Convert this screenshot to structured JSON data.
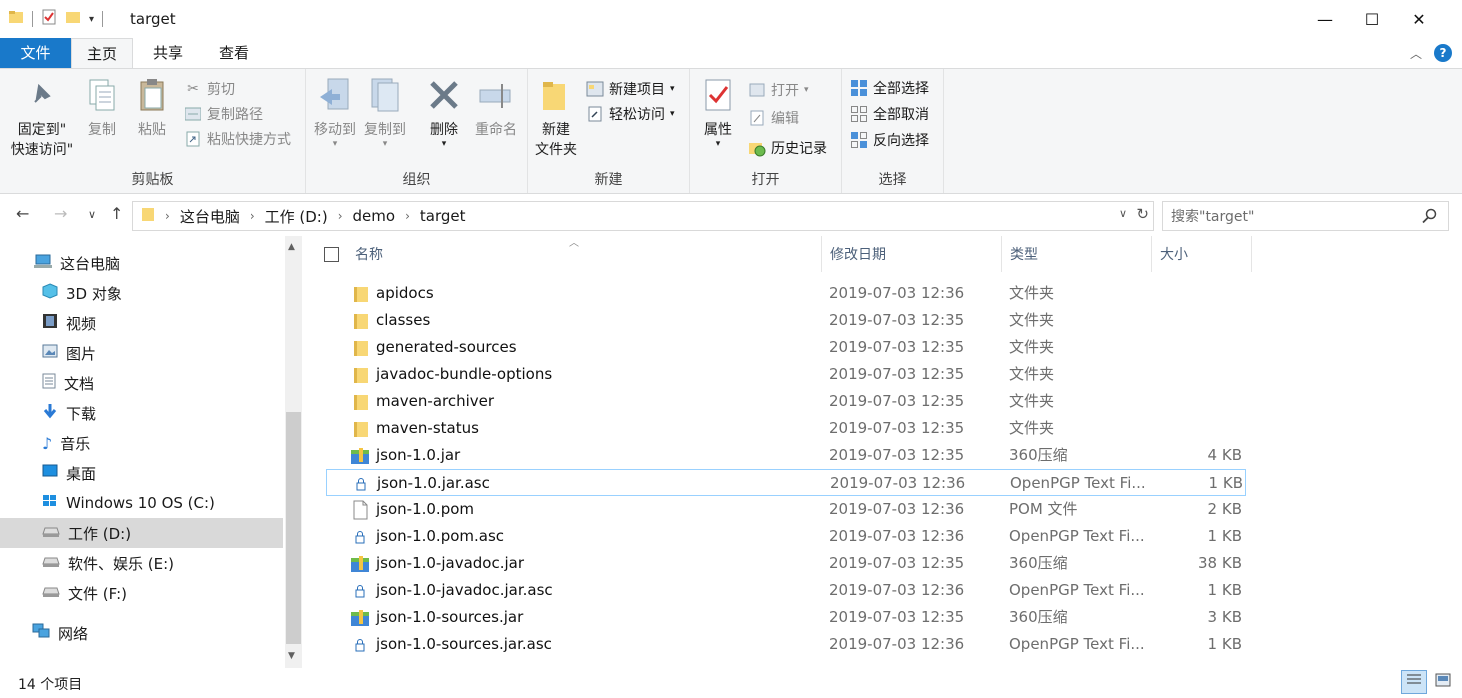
{
  "window": {
    "title": "target",
    "minimize": "—",
    "maximize": "☐",
    "close": "✕"
  },
  "ribbon_tabs": [
    "文件",
    "主页",
    "共享",
    "查看"
  ],
  "ribbon": {
    "clipboard": {
      "label": "剪贴板",
      "pin": "固定到\"\n快速访问\"",
      "pin_line1": "固定到\"",
      "pin_line2": "快速访问\"",
      "copy": "复制",
      "paste": "粘贴",
      "cut": "剪切",
      "copy_path": "复制路径",
      "paste_shortcut": "粘贴快捷方式"
    },
    "organize": {
      "label": "组织",
      "move_to": "移动到",
      "copy_to": "复制到",
      "delete": "删除",
      "rename": "重命名"
    },
    "new": {
      "label": "新建",
      "new_folder_line1": "新建",
      "new_folder_line2": "文件夹",
      "new_item": "新建项目",
      "easy_access": "轻松访问"
    },
    "open": {
      "label": "打开",
      "properties": "属性",
      "open": "打开",
      "edit": "编辑",
      "history": "历史记录"
    },
    "select": {
      "label": "选择",
      "select_all": "全部选择",
      "select_none": "全部取消",
      "invert": "反向选择"
    }
  },
  "address": {
    "crumbs": [
      "这台电脑",
      "工作 (D:)",
      "demo",
      "target"
    ],
    "search_placeholder": "搜索\"target\""
  },
  "nav_pane": [
    {
      "label": "这台电脑",
      "icon": "computer-icon",
      "indent": 1
    },
    {
      "label": "3D 对象",
      "icon": "cube-icon",
      "indent": 2
    },
    {
      "label": "视频",
      "icon": "video-icon",
      "indent": 2
    },
    {
      "label": "图片",
      "icon": "pictures-icon",
      "indent": 2
    },
    {
      "label": "文档",
      "icon": "document-icon",
      "indent": 2
    },
    {
      "label": "下载",
      "icon": "download-icon",
      "indent": 2
    },
    {
      "label": "音乐",
      "icon": "music-icon",
      "indent": 2
    },
    {
      "label": "桌面",
      "icon": "desktop-icon",
      "indent": 2
    },
    {
      "label": "Windows 10 OS (C:)",
      "icon": "windows-drive-icon",
      "indent": 2
    },
    {
      "label": "工作 (D:)",
      "icon": "drive-icon",
      "indent": 2,
      "selected": true
    },
    {
      "label": "软件、娱乐 (E:)",
      "icon": "drive-icon",
      "indent": 2
    },
    {
      "label": "文件 (F:)",
      "icon": "drive-icon",
      "indent": 2
    },
    {
      "label": "网络",
      "icon": "network-icon",
      "indent": 1
    }
  ],
  "columns": {
    "name": "名称",
    "date": "修改日期",
    "type": "类型",
    "size": "大小"
  },
  "files": [
    {
      "name": "apidocs",
      "date": "2019-07-03 12:36",
      "type": "文件夹",
      "size": "",
      "icon": "folder-icon"
    },
    {
      "name": "classes",
      "date": "2019-07-03 12:35",
      "type": "文件夹",
      "size": "",
      "icon": "folder-icon"
    },
    {
      "name": "generated-sources",
      "date": "2019-07-03 12:35",
      "type": "文件夹",
      "size": "",
      "icon": "folder-icon"
    },
    {
      "name": "javadoc-bundle-options",
      "date": "2019-07-03 12:35",
      "type": "文件夹",
      "size": "",
      "icon": "folder-icon"
    },
    {
      "name": "maven-archiver",
      "date": "2019-07-03 12:35",
      "type": "文件夹",
      "size": "",
      "icon": "folder-icon"
    },
    {
      "name": "maven-status",
      "date": "2019-07-03 12:35",
      "type": "文件夹",
      "size": "",
      "icon": "folder-icon"
    },
    {
      "name": "json-1.0.jar",
      "date": "2019-07-03 12:35",
      "type": "360压缩",
      "size": "4 KB",
      "icon": "archive-icon"
    },
    {
      "name": "json-1.0.jar.asc",
      "date": "2019-07-03 12:36",
      "type": "OpenPGP Text Fi...",
      "size": "1 KB",
      "icon": "lock-file-icon",
      "focused": true
    },
    {
      "name": "json-1.0.pom",
      "date": "2019-07-03 12:36",
      "type": "POM 文件",
      "size": "2 KB",
      "icon": "blank-file-icon"
    },
    {
      "name": "json-1.0.pom.asc",
      "date": "2019-07-03 12:36",
      "type": "OpenPGP Text Fi...",
      "size": "1 KB",
      "icon": "lock-file-icon"
    },
    {
      "name": "json-1.0-javadoc.jar",
      "date": "2019-07-03 12:35",
      "type": "360压缩",
      "size": "38 KB",
      "icon": "archive-icon"
    },
    {
      "name": "json-1.0-javadoc.jar.asc",
      "date": "2019-07-03 12:36",
      "type": "OpenPGP Text Fi...",
      "size": "1 KB",
      "icon": "lock-file-icon"
    },
    {
      "name": "json-1.0-sources.jar",
      "date": "2019-07-03 12:35",
      "type": "360压缩",
      "size": "3 KB",
      "icon": "archive-icon"
    },
    {
      "name": "json-1.0-sources.jar.asc",
      "date": "2019-07-03 12:36",
      "type": "OpenPGP Text Fi...",
      "size": "1 KB",
      "icon": "lock-file-icon"
    }
  ],
  "status": {
    "item_count": "14 个项目"
  },
  "colors": {
    "accent": "#1979ca",
    "ribbon_bg": "#f5f6f7",
    "selected_nav": "#d9d9d9",
    "focus_border": "#99d1ff",
    "folder": "#f8d775"
  }
}
